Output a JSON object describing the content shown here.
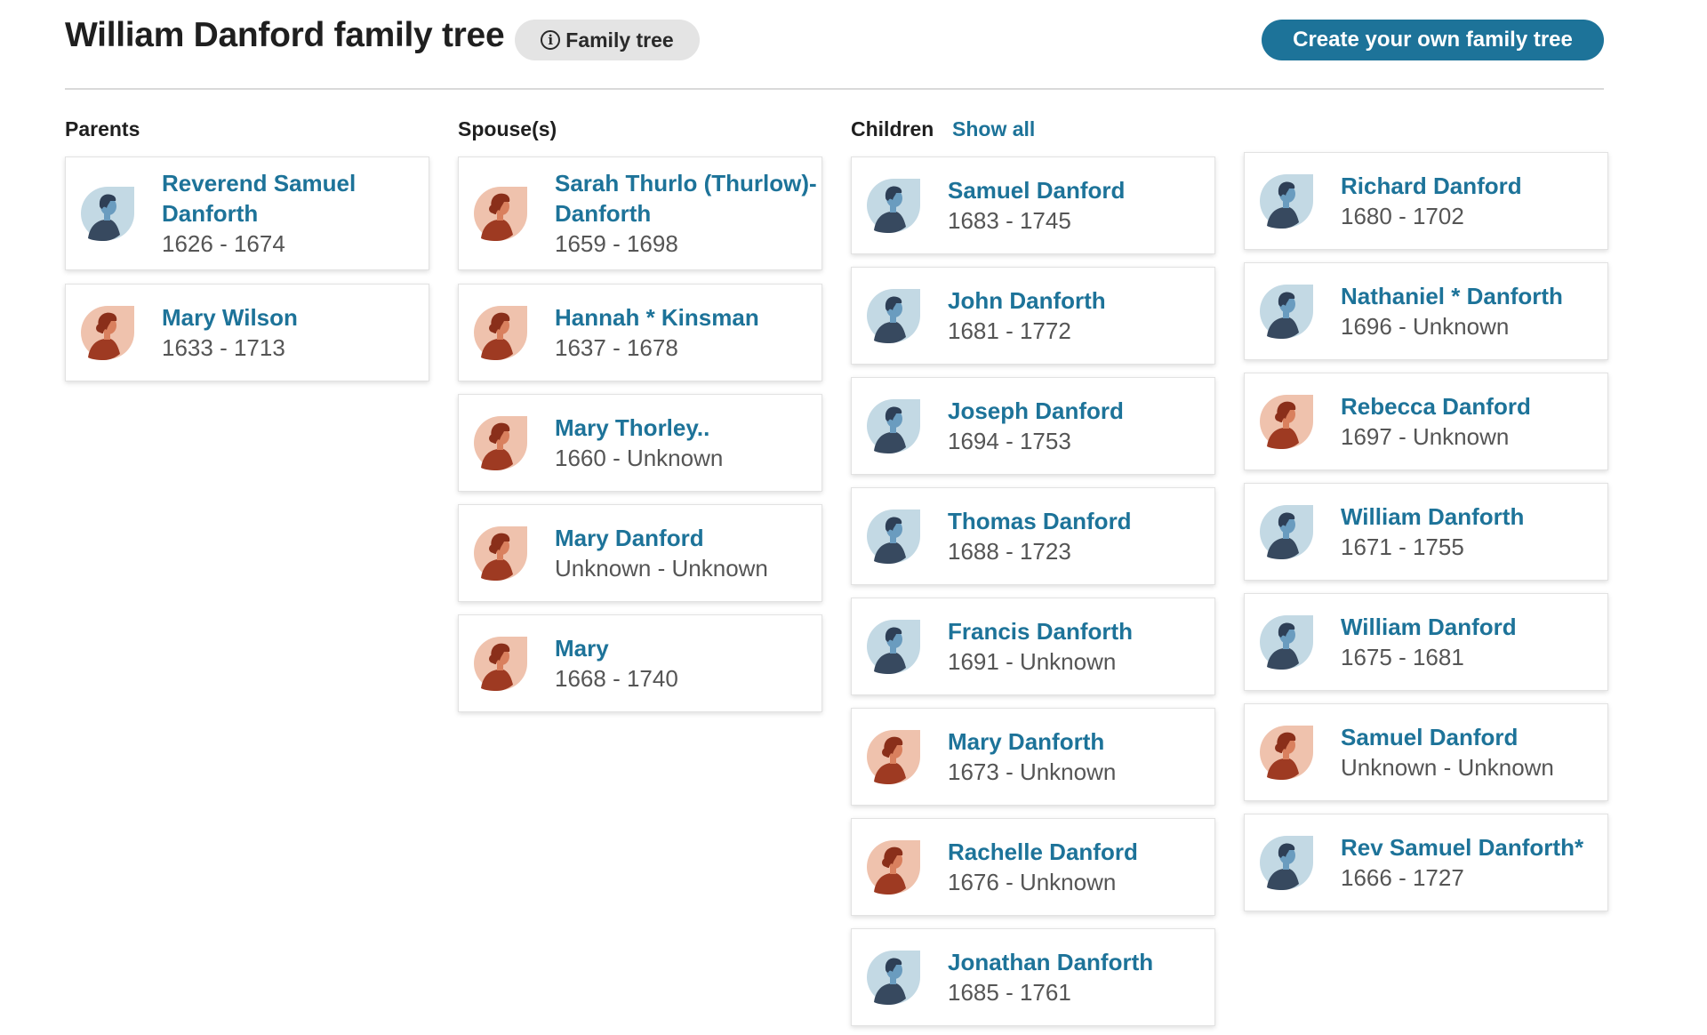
{
  "header": {
    "title": "William Danford family tree",
    "badge_label": "Family tree",
    "cta_label": "Create your own family tree"
  },
  "columns": {
    "parents": "Parents",
    "spouses": "Spouse(s)",
    "children": "Children",
    "show_all": "Show all"
  },
  "colors": {
    "link": "#1d7399",
    "cta_bg": "#1d7399",
    "male_avatar_bg": "#c3d9e4",
    "female_avatar_bg": "#efc2ad"
  },
  "parents": [
    {
      "name": "Reverend Samuel Danforth",
      "dates": "1626 - 1674",
      "gender": "male"
    },
    {
      "name": "Mary Wilson",
      "dates": "1633 - 1713",
      "gender": "female"
    }
  ],
  "spouses": [
    {
      "name": "Sarah Thurlo (Thurlow)- Danforth",
      "dates": "1659 - 1698",
      "gender": "female"
    },
    {
      "name": "Hannah * Kinsman",
      "dates": "1637 - 1678",
      "gender": "female"
    },
    {
      "name": "Mary Thorley..",
      "dates": "1660 - Unknown",
      "gender": "female"
    },
    {
      "name": "Mary Danford",
      "dates": "Unknown - Unknown",
      "gender": "female"
    },
    {
      "name": "Mary",
      "dates": "1668 - 1740",
      "gender": "female"
    }
  ],
  "children_a": [
    {
      "name": "Samuel Danford",
      "dates": "1683 - 1745",
      "gender": "male"
    },
    {
      "name": "John Danforth",
      "dates": "1681 - 1772",
      "gender": "male"
    },
    {
      "name": "Joseph Danford",
      "dates": "1694 - 1753",
      "gender": "male"
    },
    {
      "name": "Thomas Danford",
      "dates": "1688 - 1723",
      "gender": "male"
    },
    {
      "name": "Francis Danforth",
      "dates": "1691 - Unknown",
      "gender": "male"
    },
    {
      "name": "Mary Danforth",
      "dates": "1673 - Unknown",
      "gender": "female"
    },
    {
      "name": "Rachelle Danford",
      "dates": "1676 - Unknown",
      "gender": "female"
    },
    {
      "name": "Jonathan Danforth",
      "dates": "1685 - 1761",
      "gender": "male"
    }
  ],
  "children_b": [
    {
      "name": "Richard Danford",
      "dates": "1680 - 1702",
      "gender": "male"
    },
    {
      "name": "Nathaniel * Danforth",
      "dates": "1696 - Unknown",
      "gender": "male"
    },
    {
      "name": "Rebecca Danford",
      "dates": "1697 - Unknown",
      "gender": "female"
    },
    {
      "name": "William Danforth",
      "dates": "1671 - 1755",
      "gender": "male"
    },
    {
      "name": "William Danford",
      "dates": "1675 - 1681",
      "gender": "male"
    },
    {
      "name": "Samuel Danford",
      "dates": "Unknown - Unknown",
      "gender": "female"
    },
    {
      "name": "Rev Samuel Danforth*",
      "dates": "1666 - 1727",
      "gender": "male"
    }
  ]
}
